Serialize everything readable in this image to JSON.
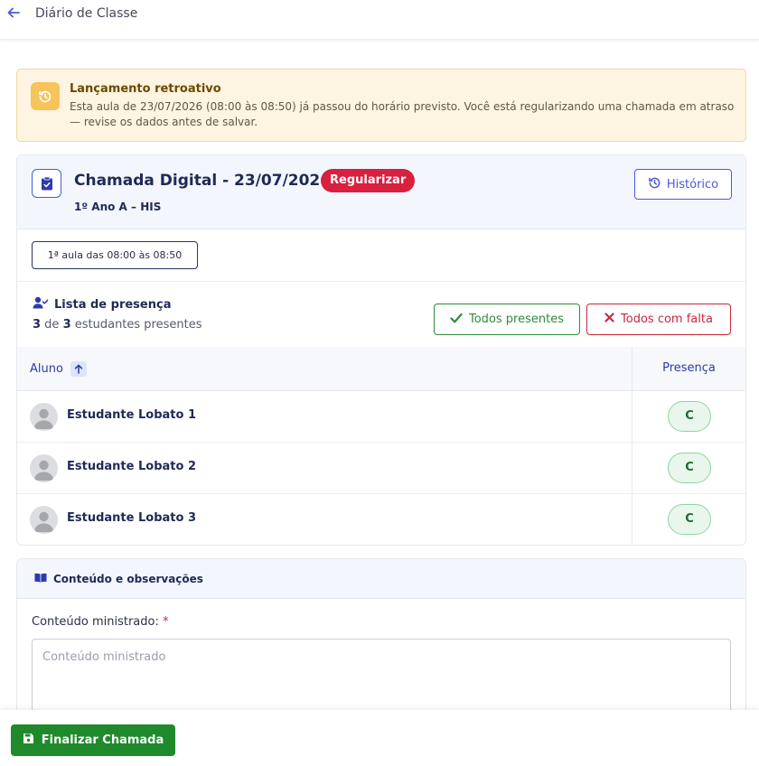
{
  "header": {
    "title": "Diário de Classe"
  },
  "alert": {
    "title": "Lançamento retroativo",
    "text": "Esta aula de 23/07/2026 (08:00 às 08:50) já passou do horário previsto. Você está regularizando uma chamada em atraso — revise os dados antes de salvar."
  },
  "chamada": {
    "title": "Chamada Digital - 23/07/2026",
    "badge": "Regularizar",
    "class_label": "1º Ano A – HIS",
    "history_button": "Histórico",
    "aula_chip": "1ª aula das 08:00 às 08:50"
  },
  "presenca": {
    "title": "Lista de presença",
    "present_count": "3",
    "count_connector": " de ",
    "total_count": "3",
    "count_suffix": " estudantes presentes",
    "all_present_button": "Todos presentes",
    "all_absent_button": "Todos com falta",
    "col_student": "Aluno",
    "col_presence": "Presença",
    "rows": [
      {
        "name": "Estudante Lobato 1",
        "status": "C"
      },
      {
        "name": "Estudante Lobato 2",
        "status": "C"
      },
      {
        "name": "Estudante Lobato 3",
        "status": "C"
      }
    ]
  },
  "conteudo": {
    "title": "Conteúdo e observações",
    "field_label": "Conteúdo ministrado:",
    "required_mark": "*",
    "placeholder": "Conteúdo ministrado"
  },
  "footer": {
    "finish_button": "Finalizar Chamada"
  },
  "colors": {
    "accent": "#4a5bd6",
    "danger": "#d8203f",
    "success": "#1e8a2c",
    "warning_bg": "#fdf4e1"
  }
}
